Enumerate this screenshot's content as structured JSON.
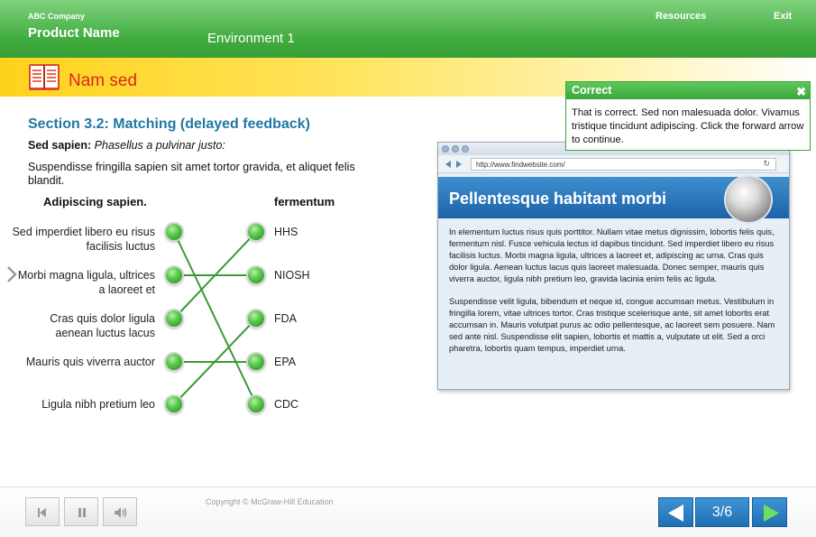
{
  "header": {
    "company": "ABC Company",
    "product": "Product Name",
    "environment": "Environment 1",
    "resources": "Resources",
    "exit": "Exit"
  },
  "banner": {
    "title": "Nam sed",
    "icon": "book-icon"
  },
  "content": {
    "section_title": "Section 3.2: Matching (delayed feedback)",
    "subtitle_bold": "Sed sapien:",
    "subtitle_italic": "Phasellus a pulvinar justo:",
    "instructions": "Suspendisse fringilla sapien sit amet tortor gravida, et aliquet felis blandit.",
    "left_header": "Adipiscing sapien.",
    "right_header": "fermentum",
    "left_items": [
      "Sed imperdiet libero eu risus facilisis luctus",
      "Morbi magna ligula, ultrices a laoreet et",
      "Cras quis dolor ligula aenean luctus lacus",
      "Mauris quis viverra auctor",
      "Ligula nibh pretium leo"
    ],
    "right_items": [
      "HHS",
      "NIOSH",
      "FDA",
      "EPA",
      "CDC"
    ],
    "matches": [
      [
        0,
        4
      ],
      [
        1,
        1
      ],
      [
        2,
        0
      ],
      [
        3,
        3
      ],
      [
        4,
        2
      ]
    ]
  },
  "browser": {
    "url": "http://www.findwebsite.com/",
    "banner_title": "Pellentesque habitant morbi",
    "paragraph1": "In elementum luctus risus quis porttitor. Nullam vitae metus dignissim, lobortis felis quis, fermentum nisl. Fusce vehicula lectus id dapibus tincidunt. Sed imperdiet libero eu risus facilisis luctus. Morbi magna ligula, ultrices a laoreet et, adipiscing ac urna. Cras quis dolor ligula. Aenean luctus lacus quis laoreet malesuada. Donec semper, mauris quis viverra auctor, ligula nibh pretium leo, gravida lacinia enim felis ac ligula.",
    "paragraph2": "Suspendisse velit ligula, bibendum et neque id, congue accumsan metus. Vestibulum in fringilla lorem, vitae ultrices tortor. Cras tristique scelerisque ante, sit amet lobortis erat accumsan in. Mauris volutpat purus ac odio pellentesque, ac laoreet sem posuere. Nam sed ante nisl. Suspendisse elit sapien, lobortis et mattis a, vulputate ut elit. Sed a orci pharetra, lobortis quam tempus, imperdiet urna."
  },
  "popup": {
    "title": "Correct",
    "body": "That is correct. Sed non malesuada dolor. Vivamus tristique tincidunt adipiscing. Click the forward arrow to continue."
  },
  "footer": {
    "copyright": "Copyright © McGraw-Hill Education",
    "page_indicator": "3/6"
  },
  "colors": {
    "header_green": "#3faa3e",
    "banner_yellow": "#ffd21a",
    "title_blue": "#1f78a4",
    "banner_red": "#d9261c",
    "line_green": "#3a9a34",
    "nav_blue": "#1f6fb3"
  }
}
